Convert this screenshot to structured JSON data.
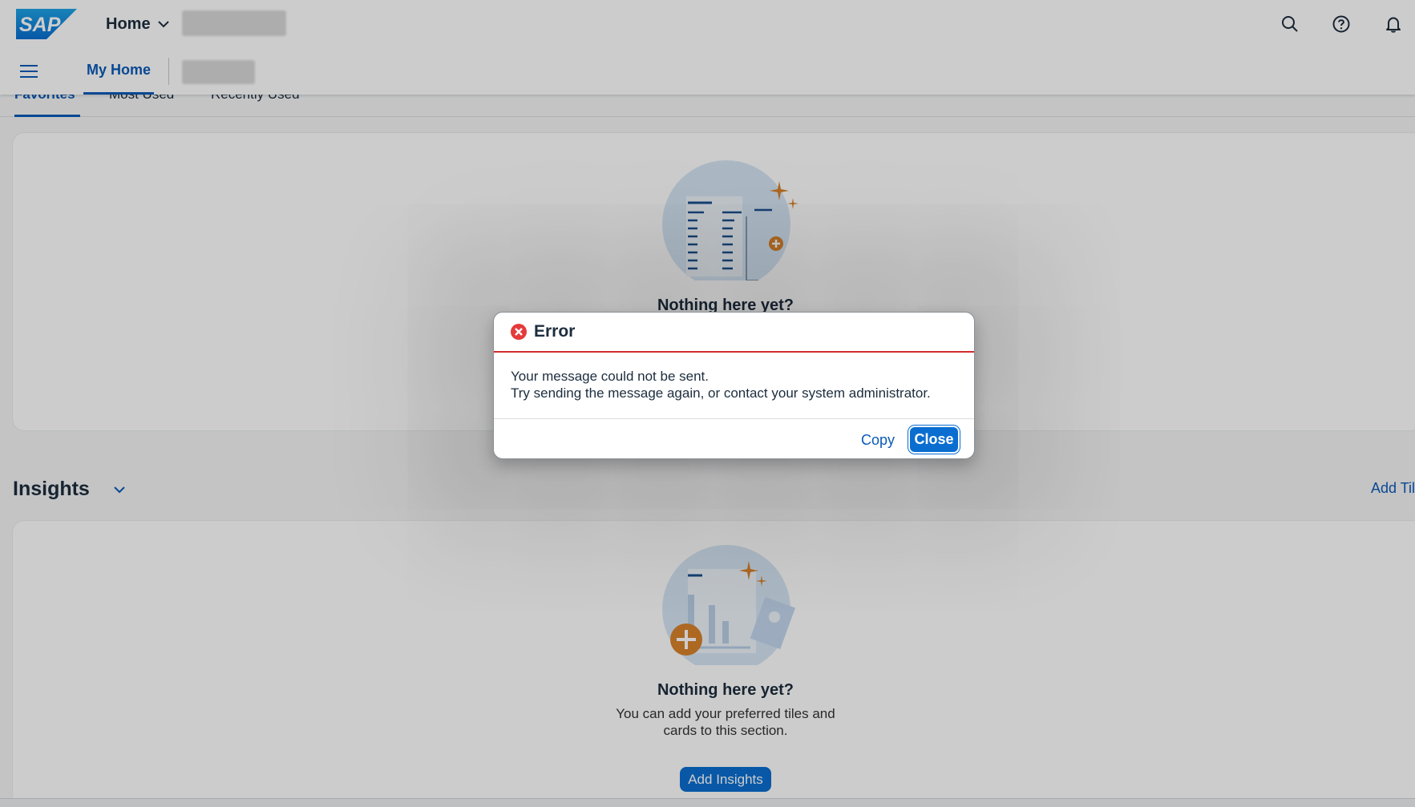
{
  "shell": {
    "logo_text": "SAP",
    "home_label": "Home",
    "icons": [
      "search-icon",
      "help-icon",
      "bell-icon"
    ]
  },
  "subnav": {
    "my_home_label": "My Home"
  },
  "page_tabs": [
    "Favorites",
    "Most Used",
    "Recently Used"
  ],
  "favorites_empty": {
    "title": "Nothing here yet?"
  },
  "insights": {
    "title": "Insights",
    "add_tiles_label": "Add Til",
    "empty_title": "Nothing here yet?",
    "empty_desc_line1": "You can add your preferred tiles and",
    "empty_desc_line2": "cards to this section.",
    "add_button_label": "Add Insights"
  },
  "dialog": {
    "title": "Error",
    "message_line1": "Your message could not be sent.",
    "message_line2": "Try sending the message again, or contact your system administrator.",
    "copy_label": "Copy",
    "close_label": "Close"
  },
  "colors": {
    "brand_blue": "#0a6ed1",
    "link_blue": "#0a5ab8",
    "error_red": "#d22b2b",
    "accent_orange": "#d9822b"
  }
}
